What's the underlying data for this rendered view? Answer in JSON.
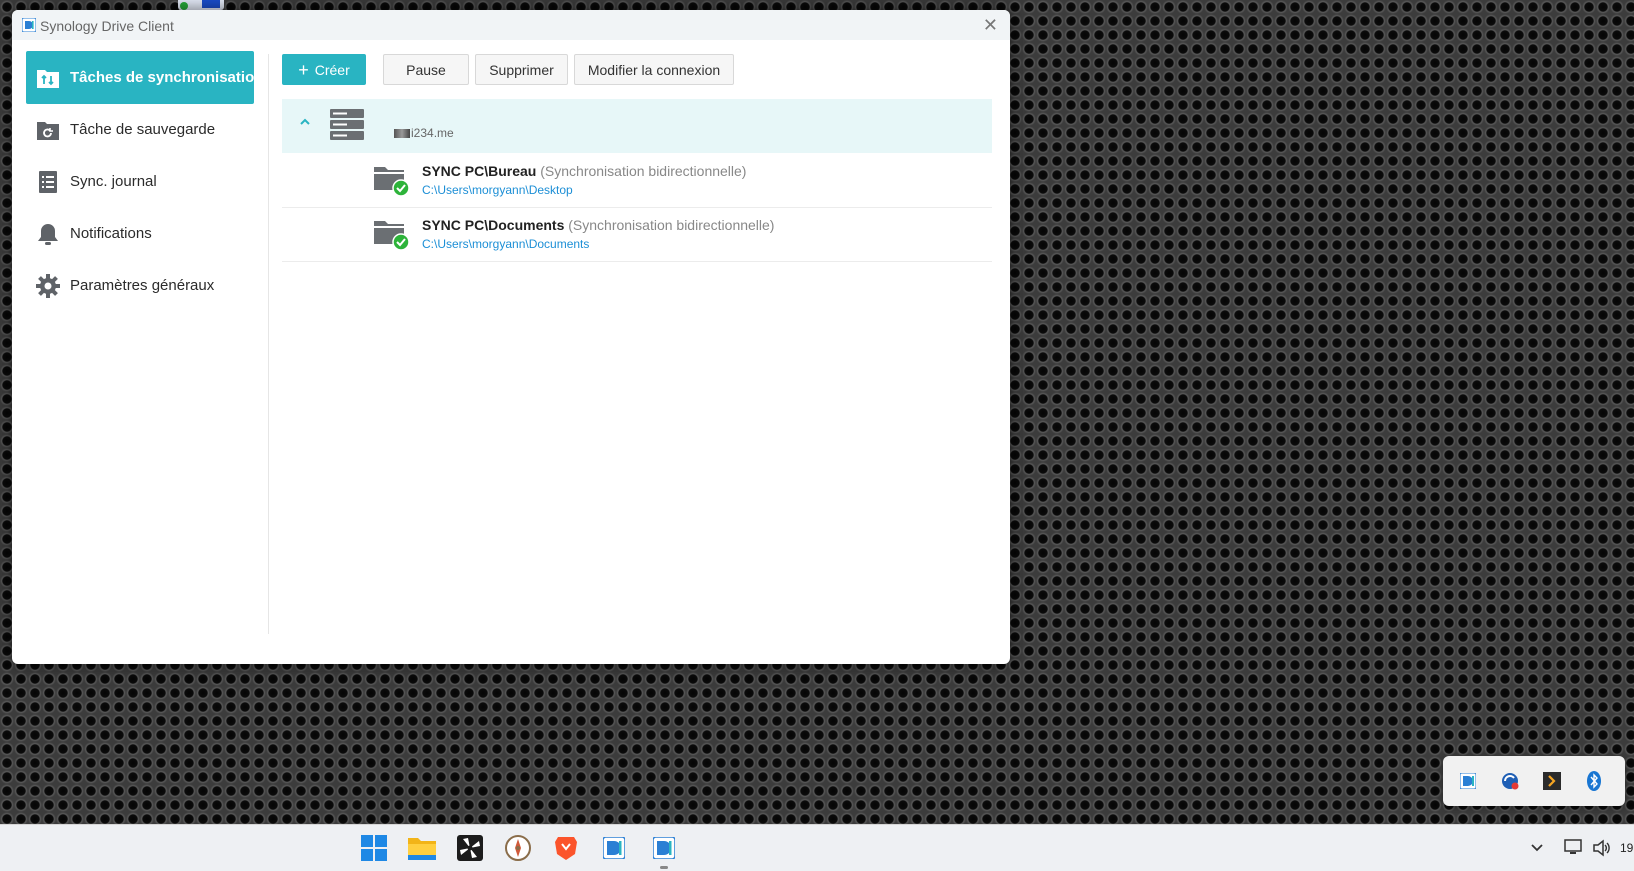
{
  "window": {
    "title": "Synology Drive Client",
    "close_glyph": "✕"
  },
  "sidebar": {
    "items": [
      {
        "label": "Tâches de synchronisation",
        "icon": "sync-tasks-icon",
        "active": true
      },
      {
        "label": "Tâche de sauvegarde",
        "icon": "backup-icon",
        "active": false
      },
      {
        "label": "Sync. journal",
        "icon": "journal-icon",
        "active": false
      },
      {
        "label": "Notifications",
        "icon": "bell-icon",
        "active": false
      },
      {
        "label": "Paramètres généraux",
        "icon": "gear-icon",
        "active": false
      }
    ]
  },
  "toolbar": {
    "create_label": "Créer",
    "create_plus": "+",
    "pause_label": "Pause",
    "delete_label": "Supprimer",
    "edit_connection_label": "Modifier la connexion"
  },
  "server": {
    "name": "i234.me",
    "icon": "server-icon",
    "expanded": true
  },
  "tasks": [
    {
      "name": "SYNC PC\\Bureau",
      "mode": "(Synchronisation bidirectionnelle)",
      "path": "C:\\Users\\morgyann\\Desktop",
      "status": "synced"
    },
    {
      "name": "SYNC PC\\Documents",
      "mode": "(Synchronisation bidirectionnelle)",
      "path": "C:\\Users\\morgyann\\Documents",
      "status": "synced"
    }
  ],
  "tray_popup": {
    "icons": [
      "synology-drive-tray-icon",
      "sync-app-tray-icon",
      "terminal-tray-icon",
      "bluetooth-tray-icon"
    ]
  },
  "taskbar": {
    "apps": [
      "windows-start-icon",
      "file-explorer-icon",
      "fan-app-icon",
      "compass-app-icon",
      "brave-browser-icon",
      "synology-drive-icon",
      "synology-drive-active-icon"
    ],
    "clock_partial": "19"
  },
  "colors": {
    "accent": "#29b4c2",
    "link": "#1d8fd6",
    "success": "#2db33a"
  }
}
